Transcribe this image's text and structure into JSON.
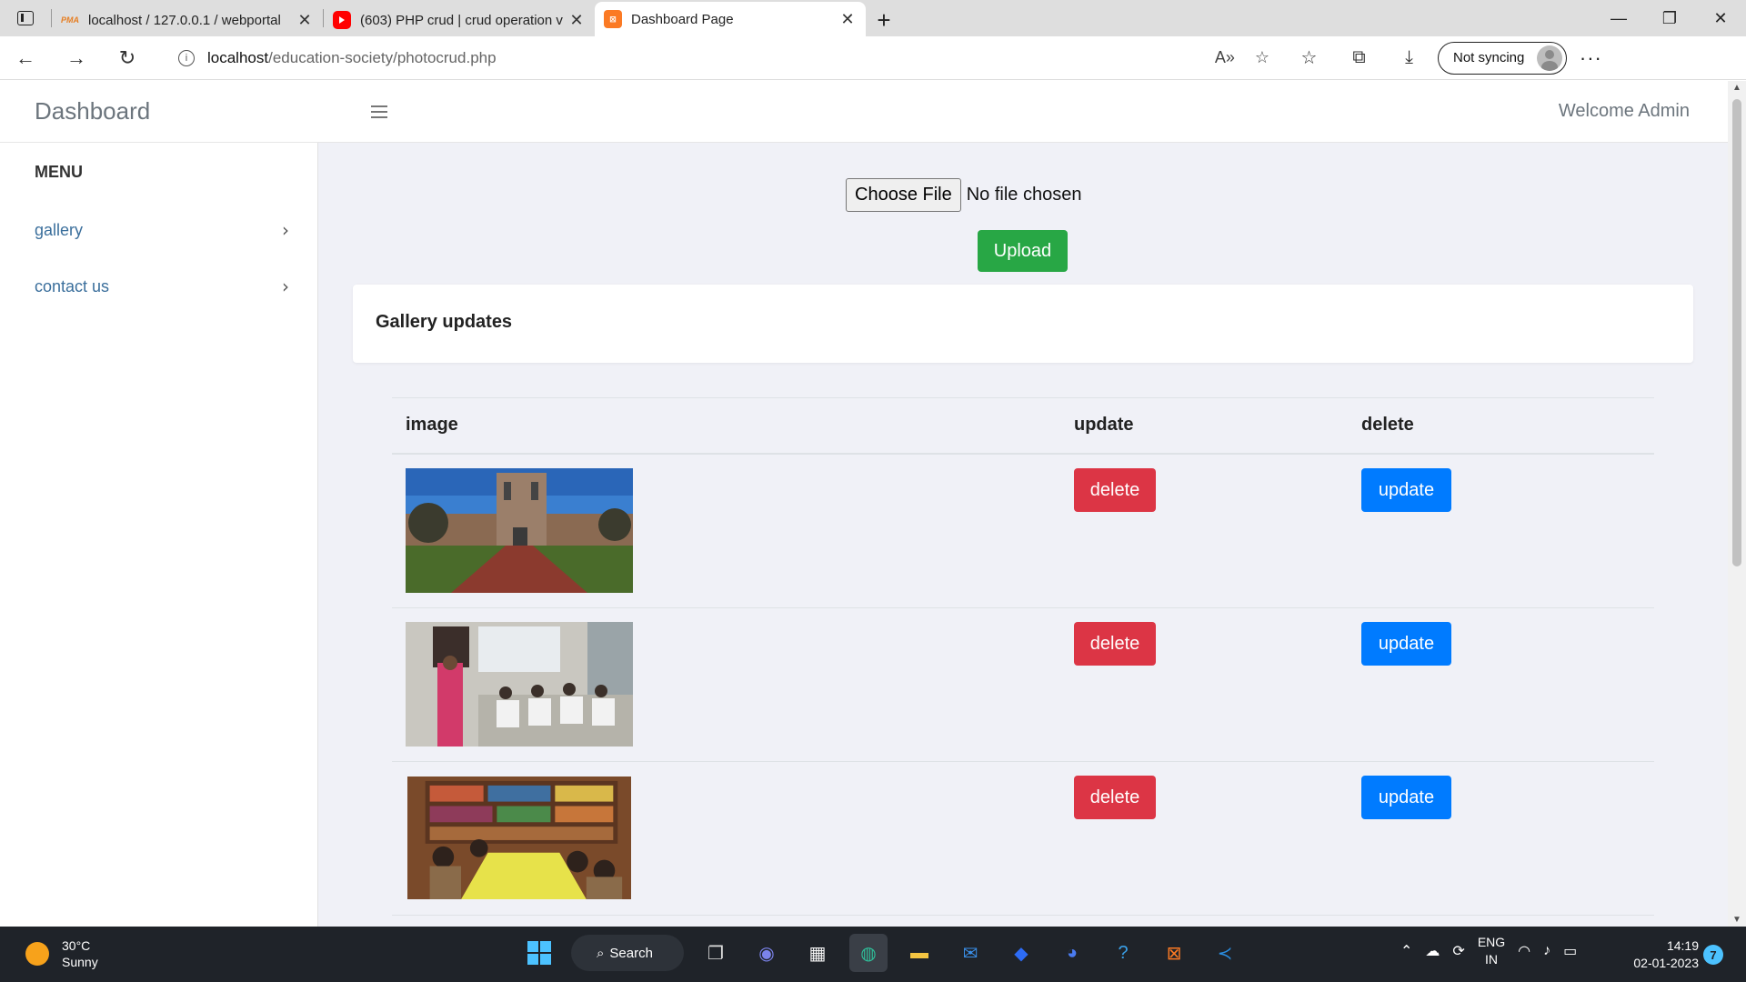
{
  "browser": {
    "tabs": [
      {
        "title": "localhost / 127.0.0.1 / webportal",
        "icon": "phpmyadmin-icon",
        "favicon_text": "PMA"
      },
      {
        "title": "(603) PHP crud | crud operation v",
        "icon": "youtube-icon"
      },
      {
        "title": "Dashboard Page",
        "icon": "xampp-icon",
        "active": true
      }
    ],
    "url_host": "localhost",
    "url_path": "/education-society/photocrud.php",
    "profile_label": "Not syncing"
  },
  "header": {
    "brand": "Dashboard",
    "welcome": "Welcome Admin"
  },
  "sidebar": {
    "title": "MENU",
    "items": [
      {
        "label": "gallery"
      },
      {
        "label": "contact us"
      }
    ]
  },
  "upload": {
    "choose_label": "Choose File",
    "status": "No file chosen",
    "button": "Upload"
  },
  "gallery": {
    "title": "Gallery updates",
    "columns": [
      "image",
      "update",
      "delete"
    ],
    "rows": [
      {
        "image": "university-building-photo",
        "first_button": "delete",
        "second_button": "update"
      },
      {
        "image": "classroom-teacher-photo",
        "first_button": "delete",
        "second_button": "update"
      },
      {
        "image": "library-students-photo",
        "first_button": "delete",
        "second_button": "update"
      }
    ]
  },
  "taskbar": {
    "temperature": "30°C",
    "condition": "Sunny",
    "search_label": "Search",
    "lang_line1": "ENG",
    "lang_line2": "IN",
    "time": "14:19",
    "date": "02-01-2023",
    "notification_count": "7"
  },
  "colors": {
    "upload_green": "#28a745",
    "delete_red": "#dc3545",
    "update_blue": "#007bff",
    "page_bg": "#f0f1f7"
  }
}
